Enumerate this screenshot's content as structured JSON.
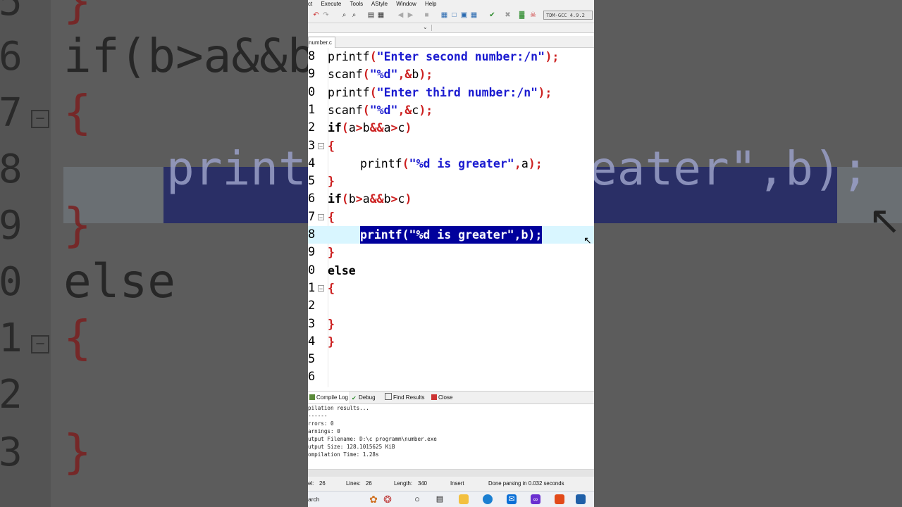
{
  "background_zoom": {
    "lines": [
      {
        "num": "5",
        "text": "}",
        "kind": "brace",
        "fold": false
      },
      {
        "num": "6",
        "text": "if(b>a&&b>",
        "kind": "code",
        "fold": false
      },
      {
        "num": "7",
        "text": "{",
        "kind": "brace",
        "fold": true
      },
      {
        "num": "8",
        "text": "printf",
        "kind": "sel",
        "fold": false,
        "tail": "eater\",b);"
      },
      {
        "num": "9",
        "text": "}",
        "kind": "brace",
        "fold": false
      },
      {
        "num": "0",
        "text": "else",
        "kind": "code",
        "fold": false
      },
      {
        "num": "1",
        "text": "{",
        "kind": "brace",
        "fold": true
      },
      {
        "num": "2",
        "text": "",
        "kind": "code",
        "fold": false
      },
      {
        "num": "3",
        "text": "}",
        "kind": "brace",
        "fold": false
      }
    ]
  },
  "ide": {
    "menu": [
      "ct",
      "Execute",
      "Tools",
      "AStyle",
      "Window",
      "Help"
    ],
    "compiler": "TDM-GCC 4.9.2",
    "file_tab": "number.c",
    "lines": [
      {
        "num": "8",
        "fold": false,
        "tokens": [
          {
            "t": "printf",
            "c": "fn"
          },
          {
            "t": "(",
            "c": "op"
          },
          {
            "t": "\"Enter second number:/n\"",
            "c": "str"
          },
          {
            "t": ");",
            "c": "op"
          }
        ],
        "indent": 0
      },
      {
        "num": "9",
        "fold": false,
        "tokens": [
          {
            "t": "scanf",
            "c": "fn"
          },
          {
            "t": "(",
            "c": "op"
          },
          {
            "t": "\"%d\"",
            "c": "str"
          },
          {
            "t": ",&",
            "c": "op"
          },
          {
            "t": "b",
            "c": "fn"
          },
          {
            "t": ");",
            "c": "op"
          }
        ],
        "indent": 0
      },
      {
        "num": "0",
        "fold": false,
        "tokens": [
          {
            "t": "printf",
            "c": "fn"
          },
          {
            "t": "(",
            "c": "op"
          },
          {
            "t": "\"Enter third number:/n\"",
            "c": "str"
          },
          {
            "t": ");",
            "c": "op"
          }
        ],
        "indent": 0
      },
      {
        "num": "1",
        "fold": false,
        "tokens": [
          {
            "t": "scanf",
            "c": "fn"
          },
          {
            "t": "(",
            "c": "op"
          },
          {
            "t": "\"%d\"",
            "c": "str"
          },
          {
            "t": ",&",
            "c": "op"
          },
          {
            "t": "c",
            "c": "fn"
          },
          {
            "t": ");",
            "c": "op"
          }
        ],
        "indent": 0
      },
      {
        "num": "2",
        "fold": false,
        "tokens": [
          {
            "t": "if",
            "c": "kw"
          },
          {
            "t": "(",
            "c": "op"
          },
          {
            "t": "a",
            "c": "fn"
          },
          {
            "t": ">",
            "c": "op"
          },
          {
            "t": "b",
            "c": "fn"
          },
          {
            "t": "&&",
            "c": "op"
          },
          {
            "t": "a",
            "c": "fn"
          },
          {
            "t": ">",
            "c": "op"
          },
          {
            "t": "c",
            "c": "fn"
          },
          {
            "t": ")",
            "c": "op"
          }
        ],
        "indent": 0
      },
      {
        "num": "3",
        "fold": true,
        "tokens": [
          {
            "t": "{",
            "c": "op"
          }
        ],
        "indent": 0
      },
      {
        "num": "4",
        "fold": false,
        "tokens": [
          {
            "t": "printf",
            "c": "fn"
          },
          {
            "t": "(",
            "c": "op"
          },
          {
            "t": "\"%d is greater\"",
            "c": "str"
          },
          {
            "t": ",",
            "c": "op"
          },
          {
            "t": "a",
            "c": "fn"
          },
          {
            "t": ");",
            "c": "op"
          }
        ],
        "indent": 1
      },
      {
        "num": "5",
        "fold": false,
        "tokens": [
          {
            "t": "}",
            "c": "op"
          }
        ],
        "indent": 0
      },
      {
        "num": "6",
        "fold": false,
        "tokens": [
          {
            "t": "if",
            "c": "kw"
          },
          {
            "t": "(",
            "c": "op"
          },
          {
            "t": "b",
            "c": "fn"
          },
          {
            "t": ">",
            "c": "op"
          },
          {
            "t": "a",
            "c": "fn"
          },
          {
            "t": "&&",
            "c": "op"
          },
          {
            "t": "b",
            "c": "fn"
          },
          {
            "t": ">",
            "c": "op"
          },
          {
            "t": "c",
            "c": "fn"
          },
          {
            "t": ")",
            "c": "op"
          }
        ],
        "indent": 0
      },
      {
        "num": "7",
        "fold": true,
        "tokens": [
          {
            "t": "{",
            "c": "op"
          }
        ],
        "indent": 0
      },
      {
        "num": "8",
        "fold": false,
        "active": true,
        "tokens": [
          {
            "t": "printf(\"%d is greater\",b);",
            "c": "sel"
          }
        ],
        "indent": 1
      },
      {
        "num": "9",
        "fold": false,
        "tokens": [
          {
            "t": "}",
            "c": "op"
          }
        ],
        "indent": 0
      },
      {
        "num": "0",
        "fold": false,
        "tokens": [
          {
            "t": "else",
            "c": "kw"
          }
        ],
        "indent": 0
      },
      {
        "num": "1",
        "fold": true,
        "tokens": [
          {
            "t": "{",
            "c": "op"
          }
        ],
        "indent": 0
      },
      {
        "num": "2",
        "fold": false,
        "tokens": [],
        "indent": 0
      },
      {
        "num": "3",
        "fold": false,
        "tokens": [
          {
            "t": "}",
            "c": "op"
          }
        ],
        "indent": 0
      },
      {
        "num": "4",
        "fold": false,
        "tokens": [
          {
            "t": "}",
            "c": "op"
          }
        ],
        "indent": 0
      },
      {
        "num": "5",
        "fold": false,
        "tokens": [],
        "indent": 0
      },
      {
        "num": "6",
        "fold": false,
        "tokens": [],
        "indent": 0
      }
    ],
    "pane_tabs": [
      "Compile Log",
      "Debug",
      "Find Results",
      "Close"
    ],
    "log": [
      "pilation results...",
      "------",
      "rrors: 0",
      "arnings: 0",
      "utput Filename: D:\\c programm\\number.exe",
      "utput Size: 128.1015625 KiB",
      "ompilation Time: 1.28s"
    ],
    "status": {
      "col": "el:",
      "col_value": "26",
      "lines_label": "Lines:",
      "lines_value": "26",
      "length_label": "Length:",
      "length_value": "340",
      "mode": "Insert",
      "message": "Done parsing in 0.032 seconds"
    },
    "taskbar_search": "arch",
    "colors": {
      "selection": "#00009c",
      "active_line": "#d9f6ff",
      "string": "#1a1ad0",
      "operator": "#cc2020"
    }
  }
}
